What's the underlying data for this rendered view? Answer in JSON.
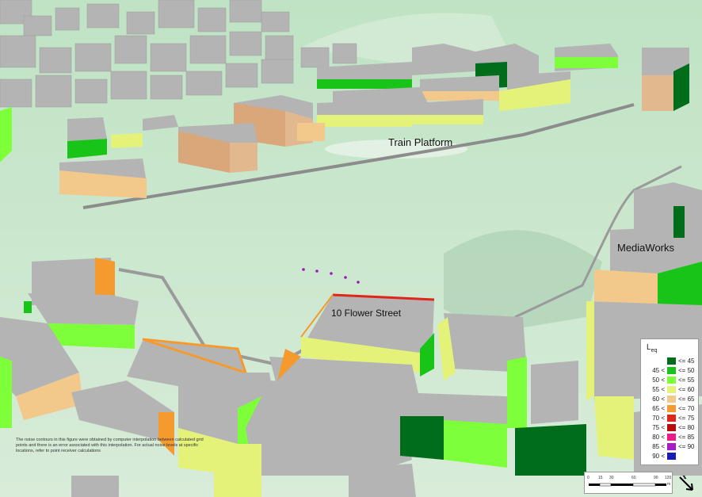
{
  "labels": {
    "train_platform": "Train Platform",
    "mediaworks": "MediaWorks",
    "flower_street": "10 Flower Street"
  },
  "note": "The noise contours in this figure were obtained by computer interpolation between calculated grid points and there is an error associated with this interpolation. For actual noise levels at specific locations, refer to point receiver calculations",
  "legend": {
    "title": "L",
    "title_sub": "eq",
    "items": [
      {
        "low": "",
        "high": "<= 45",
        "color": "#006d1a"
      },
      {
        "low": "45 <",
        "high": "<= 50",
        "color": "#19c419"
      },
      {
        "low": "50 <",
        "high": "<= 55",
        "color": "#7dff3a"
      },
      {
        "low": "55 <",
        "high": "<= 60",
        "color": "#e4f27a"
      },
      {
        "low": "60 <",
        "high": "<= 65",
        "color": "#f2c98a"
      },
      {
        "low": "65 <",
        "high": "<= 70",
        "color": "#f59a2e"
      },
      {
        "low": "70 <",
        "high": "<= 75",
        "color": "#e02619"
      },
      {
        "low": "75 <",
        "high": "<= 80",
        "color": "#b80d0d"
      },
      {
        "low": "80 <",
        "high": "<= 85",
        "color": "#ee1a8c"
      },
      {
        "low": "85 <",
        "high": "<= 90",
        "color": "#a61ac9"
      },
      {
        "low": "90 <",
        "high": "",
        "color": "#1a1ab8"
      }
    ]
  },
  "scale": {
    "ticks": [
      "0",
      "15",
      "30",
      "60",
      "90",
      "120"
    ],
    "unit": "m"
  },
  "colors": {
    "ground": "#cfe8d3",
    "roof": "#b4b4b4",
    "facade_quiet": "#f2c98a",
    "facade_loud": "#f59a2e",
    "rail": "#8c8c8c",
    "flower_edge": "#e02619"
  }
}
